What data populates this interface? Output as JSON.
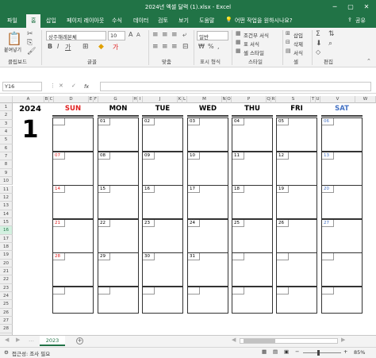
{
  "window": {
    "title": "2024년 엑셀 달력 (1).xlsx  -  Excel"
  },
  "tabs": [
    "파일",
    "홈",
    "삽입",
    "페이지 레이아웃",
    "수식",
    "데이터",
    "검토",
    "보기",
    "도움말"
  ],
  "tell_me": "어떤 작업을 원하시나요?",
  "share": "공유",
  "ribbon": {
    "clipboard": {
      "label": "클립보드",
      "paste": "붙여넣기"
    },
    "font": {
      "label": "글꼴",
      "name": "상주해례본체",
      "size": "10"
    },
    "alignment": {
      "label": "맞춤"
    },
    "number": {
      "label": "표시 형식",
      "format": "일반"
    },
    "styles": {
      "label": "스타일",
      "conditional": "조건부 서식",
      "table": "표 서식",
      "cell": "셀 스타일"
    },
    "cells": {
      "label": "셀",
      "insert": "삽입",
      "delete": "삭제",
      "format": "서식"
    },
    "editing": {
      "label": "편집"
    }
  },
  "formula_bar": {
    "name_box": "Y16",
    "fx": "fx",
    "content": ""
  },
  "columns": [
    "A",
    "B",
    "C",
    "D",
    "E",
    "F",
    "G",
    "H",
    "I",
    "J",
    "K",
    "L",
    "M",
    "N",
    "O",
    "P",
    "Q",
    "R",
    "S",
    "T",
    "U",
    "V",
    "W"
  ],
  "rows": [
    "1",
    "2",
    "3",
    "4",
    "5",
    "6",
    "7",
    "8",
    "9",
    "10",
    "11",
    "12",
    "13",
    "14",
    "15",
    "16",
    "17",
    "18",
    "19",
    "20",
    "21",
    "22",
    "23",
    "24",
    "25",
    "26",
    "27",
    "28",
    "29",
    "30"
  ],
  "selected_row": "16",
  "calendar": {
    "year": "2024",
    "month": "1",
    "days": [
      {
        "name": "SUN",
        "kind": "sun"
      },
      {
        "name": "MON",
        "kind": ""
      },
      {
        "name": "TUE",
        "kind": ""
      },
      {
        "name": "WED",
        "kind": ""
      },
      {
        "name": "THU",
        "kind": ""
      },
      {
        "name": "FRI",
        "kind": ""
      },
      {
        "name": "SAT",
        "kind": "sat"
      }
    ],
    "weeks": [
      [
        "",
        "01",
        "02",
        "03",
        "04",
        "05",
        "06"
      ],
      [
        "07",
        "08",
        "09",
        "10",
        "11",
        "12",
        "13"
      ],
      [
        "14",
        "15",
        "16",
        "17",
        "18",
        "19",
        "20"
      ],
      [
        "21",
        "22",
        "23",
        "24",
        "25",
        "26",
        "27"
      ],
      [
        "28",
        "29",
        "30",
        "31",
        "",
        "",
        ""
      ],
      [
        "",
        "",
        "",
        "",
        "",
        "",
        ""
      ]
    ]
  },
  "sheet_tab": "2023",
  "status": {
    "accessibility": "접근성: 조사 필요",
    "zoom": "85%"
  },
  "colors": {
    "accent": "#217346",
    "sunday": "#e02020",
    "saturday": "#4472c4"
  }
}
